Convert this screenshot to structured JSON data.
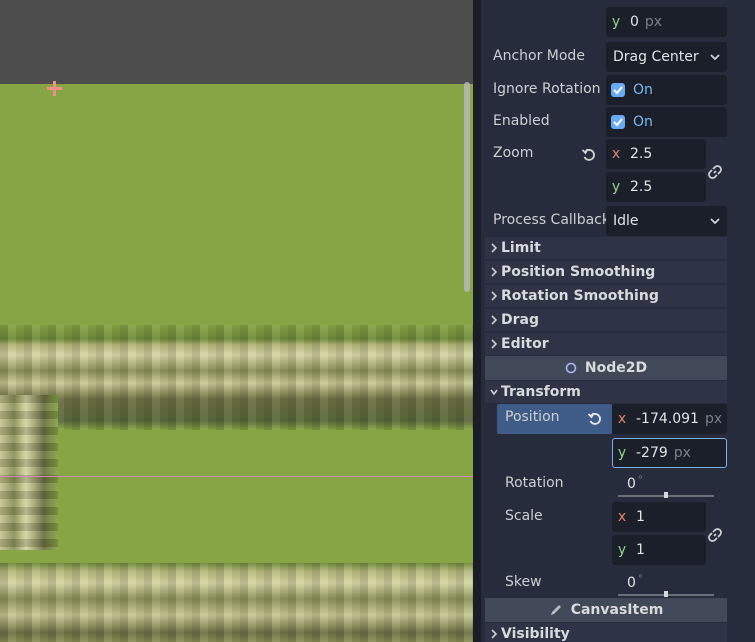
{
  "inspector": {
    "offset_y": {
      "axis": "y",
      "value": "0",
      "unit": "px"
    },
    "anchor_mode": {
      "label": "Anchor Mode",
      "value": "Drag Center"
    },
    "ignore_rotation": {
      "label": "Ignore Rotation",
      "value": "On"
    },
    "enabled": {
      "label": "Enabled",
      "value": "On"
    },
    "zoom": {
      "label": "Zoom",
      "x_axis": "x",
      "x": "2.5",
      "y_axis": "y",
      "y": "2.5"
    },
    "process_callback": {
      "label": "Process Callback",
      "value": "Idle"
    },
    "sections": {
      "limit": "Limit",
      "position_smoothing": "Position Smoothing",
      "rotation_smoothing": "Rotation Smoothing",
      "drag": "Drag",
      "editor": "Editor"
    },
    "node2d": {
      "header": "Node2D",
      "transform": "Transform",
      "position": {
        "label": "Position",
        "x_axis": "x",
        "x": "-174.091",
        "y_axis": "y",
        "y": "-279",
        "unit": "px"
      },
      "rotation": {
        "label": "Rotation",
        "value": "0",
        "unit": "°",
        "slider_fraction": 0.5
      },
      "scale": {
        "label": "Scale",
        "x_axis": "x",
        "x": "1",
        "y_axis": "y",
        "y": "1"
      },
      "skew": {
        "label": "Skew",
        "value": "0",
        "unit": "°",
        "slider_fraction": 0.5
      }
    },
    "canvas_item": {
      "header": "CanvasItem",
      "visibility": "Visibility"
    }
  },
  "colors": {
    "inspector_bg": "#262c3b",
    "field_bg": "#1b1f29",
    "accent": "#6aaaf0",
    "x_axis": "#e0826e",
    "y_axis": "#8ed48a",
    "grass": "#88a546"
  },
  "icons": {
    "revert": "revert-icon",
    "link": "link-icon",
    "checkbox": "checkbox-checked-icon",
    "dropdown": "chevron-down-icon",
    "node2d": "node2d-circle-icon",
    "canvas_item": "pencil-icon"
  }
}
